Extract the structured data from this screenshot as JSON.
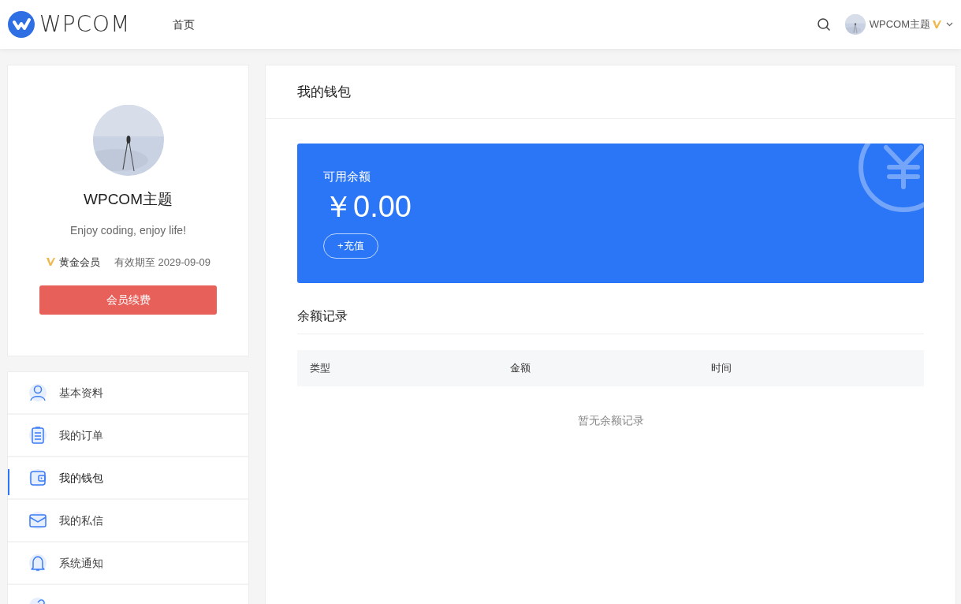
{
  "header": {
    "logo_text": "WPCOM",
    "nav": [
      {
        "label": "首页",
        "selected": false
      }
    ],
    "user": {
      "name": "WPCOM主题"
    }
  },
  "profile": {
    "name": "WPCOM主题",
    "bio": "Enjoy coding, enjoy life!",
    "membership": "黄金会员",
    "expiry": "有效期至 2029-09-09",
    "renew_button": "会员续费"
  },
  "menu": [
    {
      "label": "基本资料",
      "selected": false
    },
    {
      "label": "我的订单",
      "selected": false
    },
    {
      "label": "我的钱包",
      "selected": true
    },
    {
      "label": "我的私信",
      "selected": false
    },
    {
      "label": "系统通知",
      "selected": false
    },
    {
      "selected": false
    }
  ],
  "wallet": {
    "title": "我的钱包",
    "balance_label": "可用余额",
    "balance": "￥0.00",
    "recharge_button": "+充值",
    "records_title": "余额记录",
    "table": {
      "columns": [
        "类型",
        "金额",
        "时间"
      ],
      "empty_text": "暂无余额记录"
    }
  }
}
